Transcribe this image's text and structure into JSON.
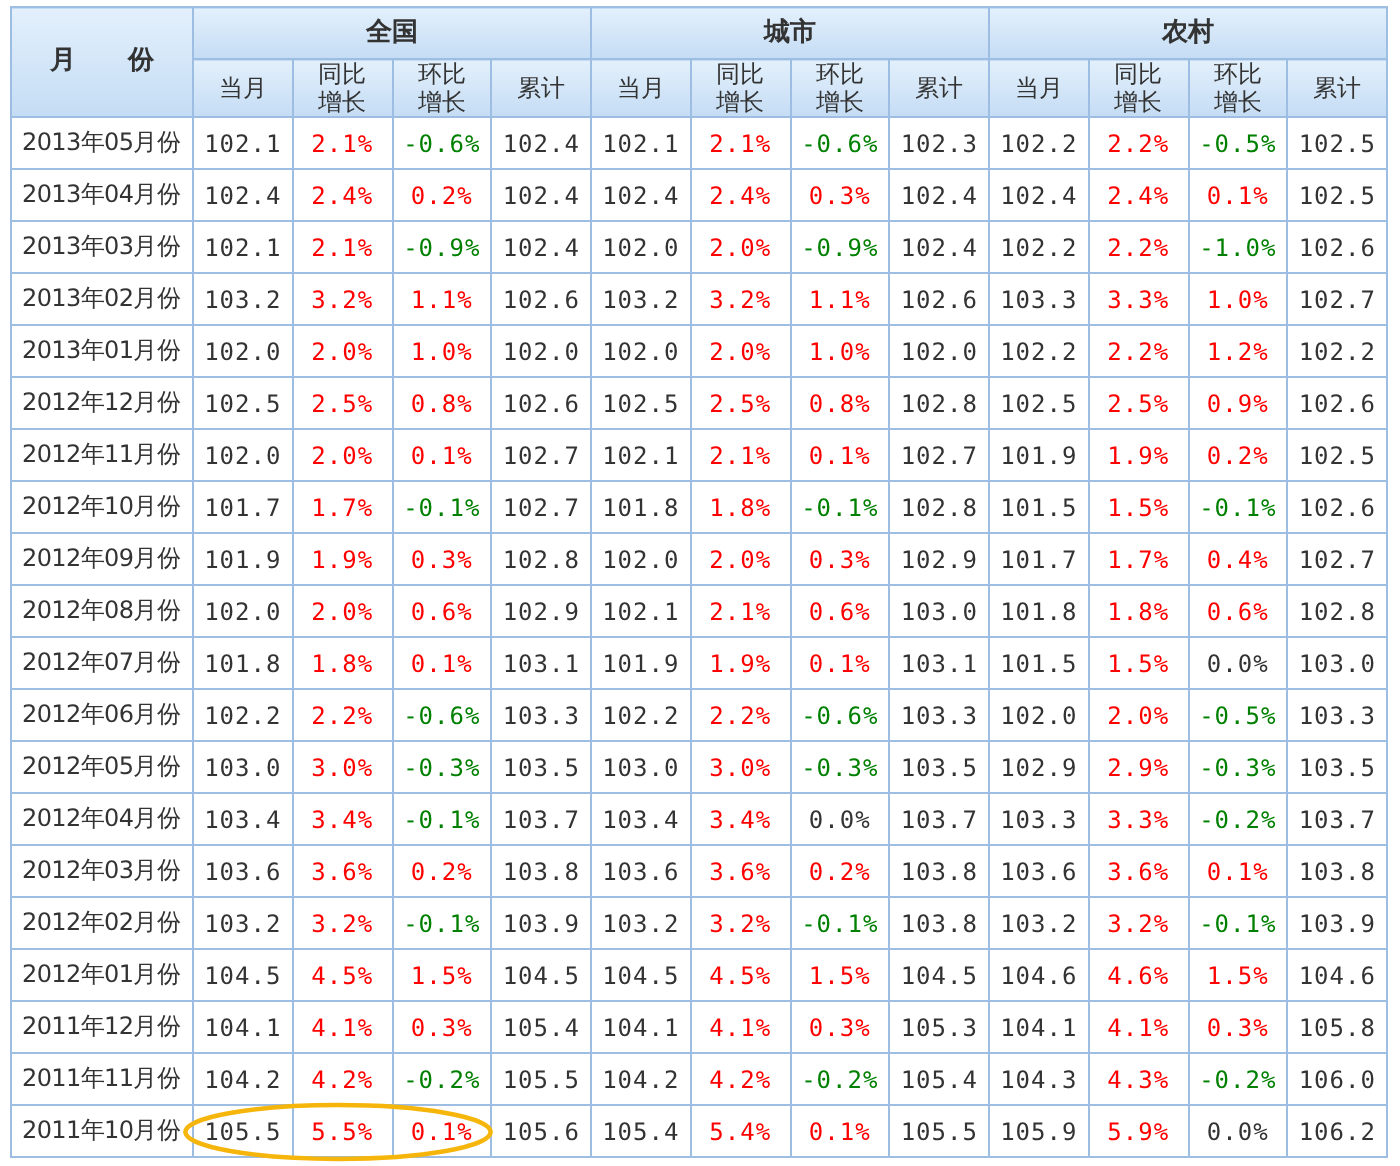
{
  "table": {
    "month_header": "月　　份",
    "groups": [
      {
        "title": "全国",
        "columns": [
          "当月",
          "同比增长",
          "环比增长",
          "累计"
        ]
      },
      {
        "title": "城市",
        "columns": [
          "当月",
          "同比增长",
          "环比增长",
          "累计"
        ]
      },
      {
        "title": "农村",
        "columns": [
          "当月",
          "同比增长",
          "环比增长",
          "累计"
        ]
      }
    ],
    "rows": [
      {
        "month": "2013年05月份",
        "circled": false,
        "groups": [
          {
            "current": "102.1",
            "yoy": {
              "value": "2.1%",
              "color": "#ff0000"
            },
            "mom": {
              "value": "-0.6%",
              "color": "#008000"
            },
            "cumulative": "102.4"
          },
          {
            "current": "102.1",
            "yoy": {
              "value": "2.1%",
              "color": "#ff0000"
            },
            "mom": {
              "value": "-0.6%",
              "color": "#008000"
            },
            "cumulative": "102.3"
          },
          {
            "current": "102.2",
            "yoy": {
              "value": "2.2%",
              "color": "#ff0000"
            },
            "mom": {
              "value": "-0.5%",
              "color": "#008000"
            },
            "cumulative": "102.5"
          }
        ]
      },
      {
        "month": "2013年04月份",
        "circled": false,
        "groups": [
          {
            "current": "102.4",
            "yoy": {
              "value": "2.4%",
              "color": "#ff0000"
            },
            "mom": {
              "value": "0.2%",
              "color": "#ff0000"
            },
            "cumulative": "102.4"
          },
          {
            "current": "102.4",
            "yoy": {
              "value": "2.4%",
              "color": "#ff0000"
            },
            "mom": {
              "value": "0.3%",
              "color": "#ff0000"
            },
            "cumulative": "102.4"
          },
          {
            "current": "102.4",
            "yoy": {
              "value": "2.4%",
              "color": "#ff0000"
            },
            "mom": {
              "value": "0.1%",
              "color": "#ff0000"
            },
            "cumulative": "102.5"
          }
        ]
      },
      {
        "month": "2013年03月份",
        "circled": false,
        "groups": [
          {
            "current": "102.1",
            "yoy": {
              "value": "2.1%",
              "color": "#ff0000"
            },
            "mom": {
              "value": "-0.9%",
              "color": "#008000"
            },
            "cumulative": "102.4"
          },
          {
            "current": "102.0",
            "yoy": {
              "value": "2.0%",
              "color": "#ff0000"
            },
            "mom": {
              "value": "-0.9%",
              "color": "#008000"
            },
            "cumulative": "102.4"
          },
          {
            "current": "102.2",
            "yoy": {
              "value": "2.2%",
              "color": "#ff0000"
            },
            "mom": {
              "value": "-1.0%",
              "color": "#008000"
            },
            "cumulative": "102.6"
          }
        ]
      },
      {
        "month": "2013年02月份",
        "circled": false,
        "groups": [
          {
            "current": "103.2",
            "yoy": {
              "value": "3.2%",
              "color": "#ff0000"
            },
            "mom": {
              "value": "1.1%",
              "color": "#ff0000"
            },
            "cumulative": "102.6"
          },
          {
            "current": "103.2",
            "yoy": {
              "value": "3.2%",
              "color": "#ff0000"
            },
            "mom": {
              "value": "1.1%",
              "color": "#ff0000"
            },
            "cumulative": "102.6"
          },
          {
            "current": "103.3",
            "yoy": {
              "value": "3.3%",
              "color": "#ff0000"
            },
            "mom": {
              "value": "1.0%",
              "color": "#ff0000"
            },
            "cumulative": "102.7"
          }
        ]
      },
      {
        "month": "2013年01月份",
        "circled": false,
        "groups": [
          {
            "current": "102.0",
            "yoy": {
              "value": "2.0%",
              "color": "#ff0000"
            },
            "mom": {
              "value": "1.0%",
              "color": "#ff0000"
            },
            "cumulative": "102.0"
          },
          {
            "current": "102.0",
            "yoy": {
              "value": "2.0%",
              "color": "#ff0000"
            },
            "mom": {
              "value": "1.0%",
              "color": "#ff0000"
            },
            "cumulative": "102.0"
          },
          {
            "current": "102.2",
            "yoy": {
              "value": "2.2%",
              "color": "#ff0000"
            },
            "mom": {
              "value": "1.2%",
              "color": "#ff0000"
            },
            "cumulative": "102.2"
          }
        ]
      },
      {
        "month": "2012年12月份",
        "circled": false,
        "groups": [
          {
            "current": "102.5",
            "yoy": {
              "value": "2.5%",
              "color": "#ff0000"
            },
            "mom": {
              "value": "0.8%",
              "color": "#ff0000"
            },
            "cumulative": "102.6"
          },
          {
            "current": "102.5",
            "yoy": {
              "value": "2.5%",
              "color": "#ff0000"
            },
            "mom": {
              "value": "0.8%",
              "color": "#ff0000"
            },
            "cumulative": "102.8"
          },
          {
            "current": "102.5",
            "yoy": {
              "value": "2.5%",
              "color": "#ff0000"
            },
            "mom": {
              "value": "0.9%",
              "color": "#ff0000"
            },
            "cumulative": "102.6"
          }
        ]
      },
      {
        "month": "2012年11月份",
        "circled": false,
        "groups": [
          {
            "current": "102.0",
            "yoy": {
              "value": "2.0%",
              "color": "#ff0000"
            },
            "mom": {
              "value": "0.1%",
              "color": "#ff0000"
            },
            "cumulative": "102.7"
          },
          {
            "current": "102.1",
            "yoy": {
              "value": "2.1%",
              "color": "#ff0000"
            },
            "mom": {
              "value": "0.1%",
              "color": "#ff0000"
            },
            "cumulative": "102.7"
          },
          {
            "current": "101.9",
            "yoy": {
              "value": "1.9%",
              "color": "#ff0000"
            },
            "mom": {
              "value": "0.2%",
              "color": "#ff0000"
            },
            "cumulative": "102.5"
          }
        ]
      },
      {
        "month": "2012年10月份",
        "circled": false,
        "groups": [
          {
            "current": "101.7",
            "yoy": {
              "value": "1.7%",
              "color": "#ff0000"
            },
            "mom": {
              "value": "-0.1%",
              "color": "#008000"
            },
            "cumulative": "102.7"
          },
          {
            "current": "101.8",
            "yoy": {
              "value": "1.8%",
              "color": "#ff0000"
            },
            "mom": {
              "value": "-0.1%",
              "color": "#008000"
            },
            "cumulative": "102.8"
          },
          {
            "current": "101.5",
            "yoy": {
              "value": "1.5%",
              "color": "#ff0000"
            },
            "mom": {
              "value": "-0.1%",
              "color": "#008000"
            },
            "cumulative": "102.6"
          }
        ]
      },
      {
        "month": "2012年09月份",
        "circled": false,
        "groups": [
          {
            "current": "101.9",
            "yoy": {
              "value": "1.9%",
              "color": "#ff0000"
            },
            "mom": {
              "value": "0.3%",
              "color": "#ff0000"
            },
            "cumulative": "102.8"
          },
          {
            "current": "102.0",
            "yoy": {
              "value": "2.0%",
              "color": "#ff0000"
            },
            "mom": {
              "value": "0.3%",
              "color": "#ff0000"
            },
            "cumulative": "102.9"
          },
          {
            "current": "101.7",
            "yoy": {
              "value": "1.7%",
              "color": "#ff0000"
            },
            "mom": {
              "value": "0.4%",
              "color": "#ff0000"
            },
            "cumulative": "102.7"
          }
        ]
      },
      {
        "month": "2012年08月份",
        "circled": false,
        "groups": [
          {
            "current": "102.0",
            "yoy": {
              "value": "2.0%",
              "color": "#ff0000"
            },
            "mom": {
              "value": "0.6%",
              "color": "#ff0000"
            },
            "cumulative": "102.9"
          },
          {
            "current": "102.1",
            "yoy": {
              "value": "2.1%",
              "color": "#ff0000"
            },
            "mom": {
              "value": "0.6%",
              "color": "#ff0000"
            },
            "cumulative": "103.0"
          },
          {
            "current": "101.8",
            "yoy": {
              "value": "1.8%",
              "color": "#ff0000"
            },
            "mom": {
              "value": "0.6%",
              "color": "#ff0000"
            },
            "cumulative": "102.8"
          }
        ]
      },
      {
        "month": "2012年07月份",
        "circled": false,
        "groups": [
          {
            "current": "101.8",
            "yoy": {
              "value": "1.8%",
              "color": "#ff0000"
            },
            "mom": {
              "value": "0.1%",
              "color": "#ff0000"
            },
            "cumulative": "103.1"
          },
          {
            "current": "101.9",
            "yoy": {
              "value": "1.9%",
              "color": "#ff0000"
            },
            "mom": {
              "value": "0.1%",
              "color": "#ff0000"
            },
            "cumulative": "103.1"
          },
          {
            "current": "101.5",
            "yoy": {
              "value": "1.5%",
              "color": "#ff0000"
            },
            "mom": {
              "value": "0.0%",
              "color": "#333333"
            },
            "cumulative": "103.0"
          }
        ]
      },
      {
        "month": "2012年06月份",
        "circled": false,
        "groups": [
          {
            "current": "102.2",
            "yoy": {
              "value": "2.2%",
              "color": "#ff0000"
            },
            "mom": {
              "value": "-0.6%",
              "color": "#008000"
            },
            "cumulative": "103.3"
          },
          {
            "current": "102.2",
            "yoy": {
              "value": "2.2%",
              "color": "#ff0000"
            },
            "mom": {
              "value": "-0.6%",
              "color": "#008000"
            },
            "cumulative": "103.3"
          },
          {
            "current": "102.0",
            "yoy": {
              "value": "2.0%",
              "color": "#ff0000"
            },
            "mom": {
              "value": "-0.5%",
              "color": "#008000"
            },
            "cumulative": "103.3"
          }
        ]
      },
      {
        "month": "2012年05月份",
        "circled": false,
        "groups": [
          {
            "current": "103.0",
            "yoy": {
              "value": "3.0%",
              "color": "#ff0000"
            },
            "mom": {
              "value": "-0.3%",
              "color": "#008000"
            },
            "cumulative": "103.5"
          },
          {
            "current": "103.0",
            "yoy": {
              "value": "3.0%",
              "color": "#ff0000"
            },
            "mom": {
              "value": "-0.3%",
              "color": "#008000"
            },
            "cumulative": "103.5"
          },
          {
            "current": "102.9",
            "yoy": {
              "value": "2.9%",
              "color": "#ff0000"
            },
            "mom": {
              "value": "-0.3%",
              "color": "#008000"
            },
            "cumulative": "103.5"
          }
        ]
      },
      {
        "month": "2012年04月份",
        "circled": false,
        "groups": [
          {
            "current": "103.4",
            "yoy": {
              "value": "3.4%",
              "color": "#ff0000"
            },
            "mom": {
              "value": "-0.1%",
              "color": "#008000"
            },
            "cumulative": "103.7"
          },
          {
            "current": "103.4",
            "yoy": {
              "value": "3.4%",
              "color": "#ff0000"
            },
            "mom": {
              "value": "0.0%",
              "color": "#333333"
            },
            "cumulative": "103.7"
          },
          {
            "current": "103.3",
            "yoy": {
              "value": "3.3%",
              "color": "#ff0000"
            },
            "mom": {
              "value": "-0.2%",
              "color": "#008000"
            },
            "cumulative": "103.7"
          }
        ]
      },
      {
        "month": "2012年03月份",
        "circled": false,
        "groups": [
          {
            "current": "103.6",
            "yoy": {
              "value": "3.6%",
              "color": "#ff0000"
            },
            "mom": {
              "value": "0.2%",
              "color": "#ff0000"
            },
            "cumulative": "103.8"
          },
          {
            "current": "103.6",
            "yoy": {
              "value": "3.6%",
              "color": "#ff0000"
            },
            "mom": {
              "value": "0.2%",
              "color": "#ff0000"
            },
            "cumulative": "103.8"
          },
          {
            "current": "103.6",
            "yoy": {
              "value": "3.6%",
              "color": "#ff0000"
            },
            "mom": {
              "value": "0.1%",
              "color": "#ff0000"
            },
            "cumulative": "103.8"
          }
        ]
      },
      {
        "month": "2012年02月份",
        "circled": false,
        "groups": [
          {
            "current": "103.2",
            "yoy": {
              "value": "3.2%",
              "color": "#ff0000"
            },
            "mom": {
              "value": "-0.1%",
              "color": "#008000"
            },
            "cumulative": "103.9"
          },
          {
            "current": "103.2",
            "yoy": {
              "value": "3.2%",
              "color": "#ff0000"
            },
            "mom": {
              "value": "-0.1%",
              "color": "#008000"
            },
            "cumulative": "103.8"
          },
          {
            "current": "103.2",
            "yoy": {
              "value": "3.2%",
              "color": "#ff0000"
            },
            "mom": {
              "value": "-0.1%",
              "color": "#008000"
            },
            "cumulative": "103.9"
          }
        ]
      },
      {
        "month": "2012年01月份",
        "circled": false,
        "groups": [
          {
            "current": "104.5",
            "yoy": {
              "value": "4.5%",
              "color": "#ff0000"
            },
            "mom": {
              "value": "1.5%",
              "color": "#ff0000"
            },
            "cumulative": "104.5"
          },
          {
            "current": "104.5",
            "yoy": {
              "value": "4.5%",
              "color": "#ff0000"
            },
            "mom": {
              "value": "1.5%",
              "color": "#ff0000"
            },
            "cumulative": "104.5"
          },
          {
            "current": "104.6",
            "yoy": {
              "value": "4.6%",
              "color": "#ff0000"
            },
            "mom": {
              "value": "1.5%",
              "color": "#ff0000"
            },
            "cumulative": "104.6"
          }
        ]
      },
      {
        "month": "2011年12月份",
        "circled": false,
        "groups": [
          {
            "current": "104.1",
            "yoy": {
              "value": "4.1%",
              "color": "#ff0000"
            },
            "mom": {
              "value": "0.3%",
              "color": "#ff0000"
            },
            "cumulative": "105.4"
          },
          {
            "current": "104.1",
            "yoy": {
              "value": "4.1%",
              "color": "#ff0000"
            },
            "mom": {
              "value": "0.3%",
              "color": "#ff0000"
            },
            "cumulative": "105.3"
          },
          {
            "current": "104.1",
            "yoy": {
              "value": "4.1%",
              "color": "#ff0000"
            },
            "mom": {
              "value": "0.3%",
              "color": "#ff0000"
            },
            "cumulative": "105.8"
          }
        ]
      },
      {
        "month": "2011年11月份",
        "circled": false,
        "groups": [
          {
            "current": "104.2",
            "yoy": {
              "value": "4.2%",
              "color": "#ff0000"
            },
            "mom": {
              "value": "-0.2%",
              "color": "#008000"
            },
            "cumulative": "105.5"
          },
          {
            "current": "104.2",
            "yoy": {
              "value": "4.2%",
              "color": "#ff0000"
            },
            "mom": {
              "value": "-0.2%",
              "color": "#008000"
            },
            "cumulative": "105.4"
          },
          {
            "current": "104.3",
            "yoy": {
              "value": "4.3%",
              "color": "#ff0000"
            },
            "mom": {
              "value": "-0.2%",
              "color": "#008000"
            },
            "cumulative": "106.0"
          }
        ]
      },
      {
        "month": "2011年10月份",
        "circled": true,
        "groups": [
          {
            "current": "105.5",
            "yoy": {
              "value": "5.5%",
              "color": "#ff0000"
            },
            "mom": {
              "value": "0.1%",
              "color": "#ff0000"
            },
            "cumulative": "105.6"
          },
          {
            "current": "105.4",
            "yoy": {
              "value": "5.4%",
              "color": "#ff0000"
            },
            "mom": {
              "value": "0.1%",
              "color": "#ff0000"
            },
            "cumulative": "105.5"
          },
          {
            "current": "105.9",
            "yoy": {
              "value": "5.9%",
              "color": "#ff0000"
            },
            "mom": {
              "value": "0.0%",
              "color": "#333333"
            },
            "cumulative": "106.2"
          }
        ]
      }
    ]
  }
}
